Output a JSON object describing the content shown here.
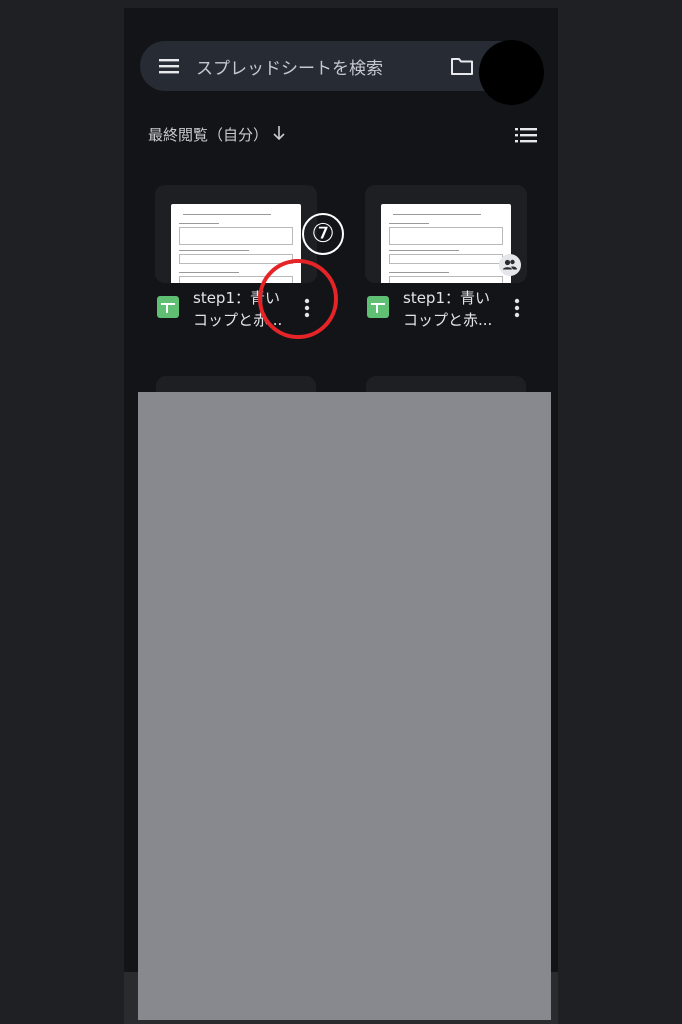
{
  "search": {
    "placeholder": "スプレッドシートを検索"
  },
  "sort": {
    "label": "最終閲覧（自分）"
  },
  "files": [
    {
      "title_line1": "step1：青い",
      "title_line2": "コップと赤..."
    },
    {
      "title_line1": "step1：青い",
      "title_line2": "コップと赤..."
    }
  ],
  "annotation": {
    "number": "⑦"
  },
  "icons": {
    "menu": "hamburger-menu",
    "folder": "folder",
    "sort_direction": "arrow-down",
    "view_toggle": "list-view",
    "file_type": "google-sheets",
    "more": "vertical-dots",
    "shared": "people"
  },
  "colors": {
    "background": "#131418",
    "search_bar": "#262b34",
    "sheets_green": "#5fbf73",
    "annotation_red": "#e52427",
    "overlay_grey": "#88898e"
  }
}
